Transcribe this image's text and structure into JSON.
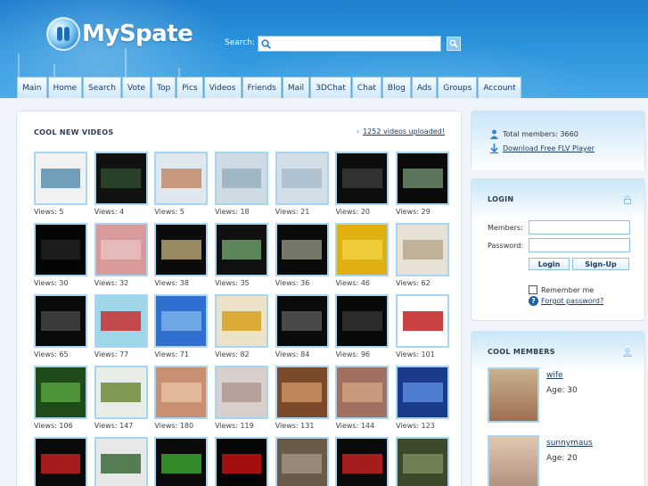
{
  "header": {
    "logo_text": "MySpate",
    "search_label": "Search:",
    "search_value": ""
  },
  "nav": {
    "tabs": [
      "Main",
      "Home",
      "Search",
      "Vote",
      "Top",
      "Pics",
      "Videos",
      "Friends",
      "Mail",
      "3DChat",
      "Chat",
      "Blog",
      "Ads",
      "Groups",
      "Account"
    ]
  },
  "videos": {
    "title": "COOL NEW VIDEOS",
    "uploaded_link": "1252 videos uploaded!",
    "items": [
      {
        "views": "Views: 5",
        "bg": "#f2f2f2",
        "accent": "#5a8fb0"
      },
      {
        "views": "Views: 4",
        "bg": "#111111",
        "accent": "#2d4a2d"
      },
      {
        "views": "Views: 5",
        "bg": "#dfe8ef",
        "accent": "#c28a6a"
      },
      {
        "views": "Views: 18",
        "bg": "#cfdbe4",
        "accent": "#9ab0c0"
      },
      {
        "views": "Views: 21",
        "bg": "#d3dfe8",
        "accent": "#a9bccb"
      },
      {
        "views": "Views: 20",
        "bg": "#0d0d0d",
        "accent": "#3a3a3a"
      },
      {
        "views": "Views: 29",
        "bg": "#0a0a0a",
        "accent": "#6a8a6a"
      },
      {
        "views": "Views: 30",
        "bg": "#050505",
        "accent": "#222222"
      },
      {
        "views": "Views: 32",
        "bg": "#d99a9a",
        "accent": "#e8c0c0"
      },
      {
        "views": "Views: 38",
        "bg": "#0b0b0b",
        "accent": "#b0a070"
      },
      {
        "views": "Views: 35",
        "bg": "#101010",
        "accent": "#6a9a6a"
      },
      {
        "views": "Views: 36",
        "bg": "#0a0a0a",
        "accent": "#8a8a7a"
      },
      {
        "views": "Views: 46",
        "bg": "#e0b010",
        "accent": "#f0d040"
      },
      {
        "views": "Views: 62",
        "bg": "#e8e2d6",
        "accent": "#b8a890"
      },
      {
        "views": "Views: 65",
        "bg": "#0a0a0a",
        "accent": "#444444"
      },
      {
        "views": "Views: 77",
        "bg": "#9fd6ea",
        "accent": "#c83030"
      },
      {
        "views": "Views: 71",
        "bg": "#2e6fd0",
        "accent": "#7ab0ea"
      },
      {
        "views": "Views: 82",
        "bg": "#ece2c8",
        "accent": "#d7a020"
      },
      {
        "views": "Views: 84",
        "bg": "#0a0a0a",
        "accent": "#555555"
      },
      {
        "views": "Views: 96",
        "bg": "#080808",
        "accent": "#333333"
      },
      {
        "views": "Views: 101",
        "bg": "#ffffff",
        "accent": "#c02020"
      },
      {
        "views": "Views: 106",
        "bg": "#1f4a1a",
        "accent": "#58a040"
      },
      {
        "views": "Views: 147",
        "bg": "#e8ede8",
        "accent": "#6a8a3a"
      },
      {
        "views": "Views: 180",
        "bg": "#c89070",
        "accent": "#e8c0a0"
      },
      {
        "views": "Views: 119",
        "bg": "#d8d0cc",
        "accent": "#b09890"
      },
      {
        "views": "Views: 131",
        "bg": "#7a4a2a",
        "accent": "#c89060"
      },
      {
        "views": "Views: 144",
        "bg": "#a07060",
        "accent": "#d0a080"
      },
      {
        "views": "Views: 123",
        "bg": "#1a3a8a",
        "accent": "#5a8ada"
      },
      {
        "views": "",
        "bg": "#0a0a0a",
        "accent": "#c02020"
      },
      {
        "views": "",
        "bg": "#e8e8e8",
        "accent": "#3a6a3a"
      },
      {
        "views": "",
        "bg": "#0a0a0a",
        "accent": "#3aa030"
      },
      {
        "views": "",
        "bg": "#050505",
        "accent": "#c01010"
      },
      {
        "views": "",
        "bg": "#6a5a4a",
        "accent": "#a09080"
      },
      {
        "views": "",
        "bg": "#0a0a0a",
        "accent": "#c02020"
      },
      {
        "views": "",
        "bg": "#3a4a2a",
        "accent": "#7a8a5a"
      }
    ]
  },
  "stats": {
    "total_members": "Total members: 3660",
    "download_link": "Download Free FLV Player"
  },
  "login": {
    "title": "LOGIN",
    "members_label": "Members:",
    "password_label": "Password:",
    "login_button": "Login",
    "signup_button": "Sign-Up",
    "remember_label": "Remember me",
    "forgot_link": "Forgot password?"
  },
  "cool_members": {
    "title": "COOL MEMBERS",
    "items": [
      {
        "name": "wife",
        "age": "Age: 30"
      },
      {
        "name": "sunnymaus",
        "age": "Age: 20"
      }
    ]
  },
  "colors": {
    "header_blue": "#2a93db",
    "link_blue": "#1a3d66",
    "thumb_border": "#a8d6f1"
  }
}
